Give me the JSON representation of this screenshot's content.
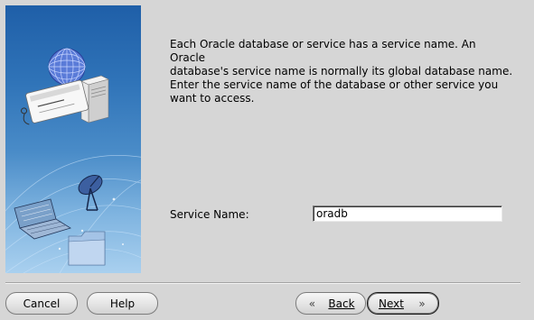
{
  "description": "Each Oracle database or service has a service name. An Oracle\ndatabase's service name is normally its global database name.\nEnter the service name of the database or other service you\nwant to access.",
  "service_name": {
    "label": "Service Name:",
    "value": "oradb"
  },
  "buttons": {
    "cancel": "Cancel",
    "help": "Help",
    "back": "Back",
    "next": "Next"
  },
  "icons": {
    "back": "double-chevron-left-icon",
    "next": "double-chevron-right-icon"
  },
  "colors": {
    "panel_top": "#1f5fa8",
    "panel_bottom": "#a9d0ef",
    "window_bg": "#d6d6d6"
  }
}
